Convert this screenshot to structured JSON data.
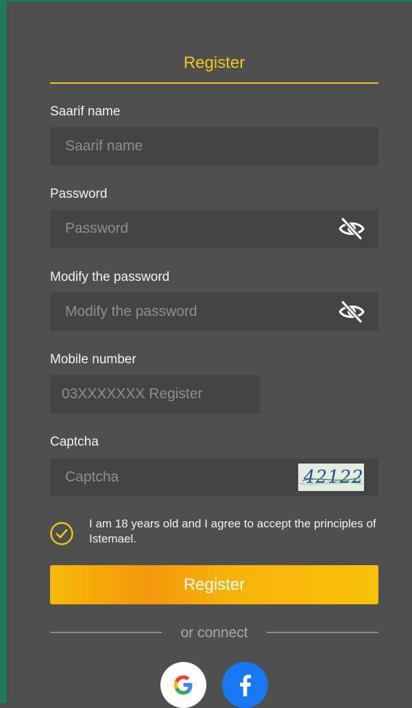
{
  "register_title": "Register",
  "fields": {
    "username": {
      "label": "Saarif name",
      "placeholder": "Saarif name"
    },
    "password": {
      "label": "Password",
      "placeholder": "Password",
      "icon": "eye-slash-icon"
    },
    "confirm_password": {
      "label": "Modify the password",
      "placeholder": "Modify the password",
      "icon": "eye-slash-icon"
    },
    "mobile": {
      "label": "Mobile number",
      "placeholder": "03XXXXXXX Register"
    },
    "captcha": {
      "label": "Captcha",
      "placeholder": "Captcha",
      "code": "42122"
    }
  },
  "agreement": {
    "text": "I am 18 years old and I agree to accept the principles of Istemael.",
    "checked": true
  },
  "register_button": "Register",
  "or_connect": "or connect",
  "social": [
    "google-icon",
    "facebook-icon"
  ],
  "colors": {
    "accent": "#f2c81a",
    "background": "#4f4f4f",
    "field": "#444444",
    "frame": "#1e7a55",
    "facebook": "#1877f2"
  }
}
